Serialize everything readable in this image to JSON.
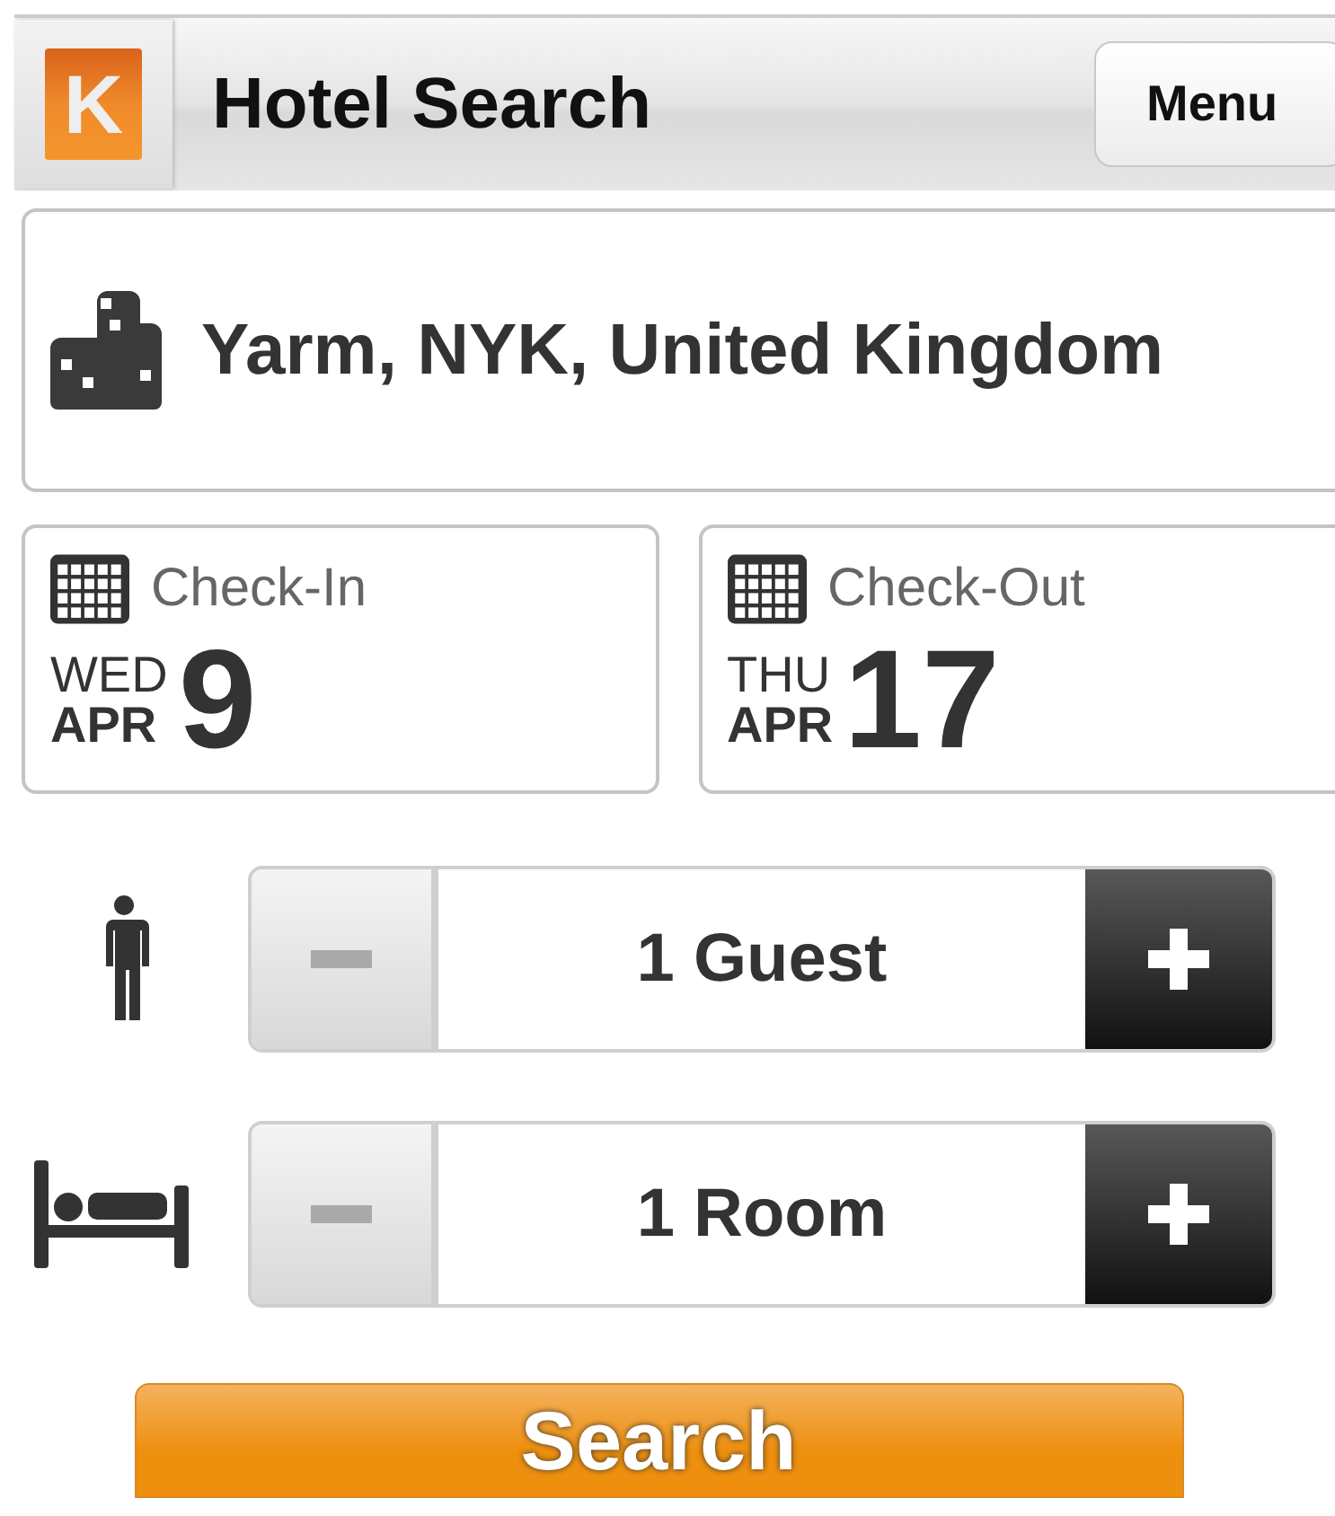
{
  "header": {
    "logo": "K",
    "title": "Hotel Search",
    "menu_button": "Menu"
  },
  "location": {
    "value": "Yarm, NYK, United Kingdom"
  },
  "dates": [
    {
      "label": "Check-In",
      "weekday": "WED",
      "month": "APR",
      "day": "9"
    },
    {
      "label": "Check-Out",
      "weekday": "THU",
      "month": "APR",
      "day": "17"
    }
  ],
  "steppers": [
    {
      "kind": "guest",
      "value": "1 Guest",
      "decrement_disabled": true,
      "increment_disabled": false
    },
    {
      "kind": "room",
      "value": "1 Room",
      "decrement_disabled": true,
      "increment_disabled": false
    }
  ],
  "search_button": "Search"
}
